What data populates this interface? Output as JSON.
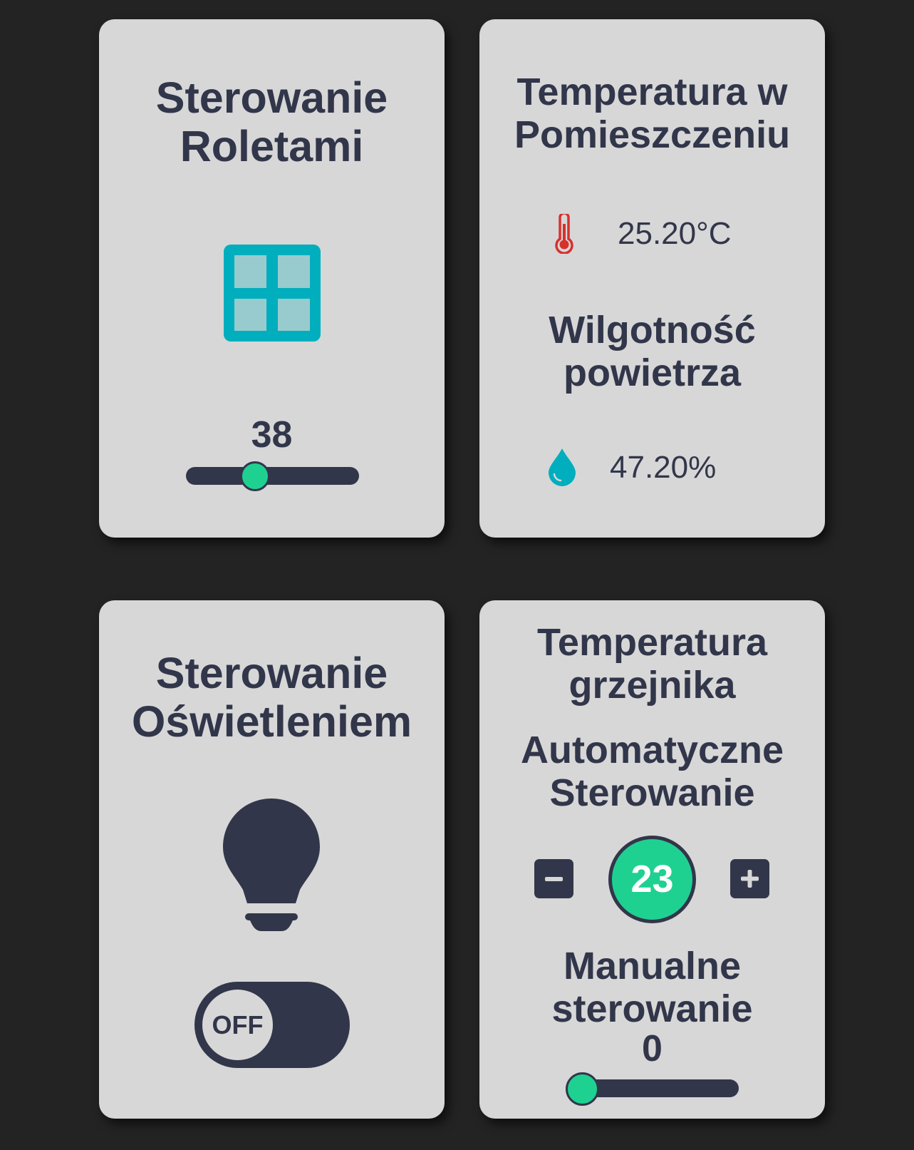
{
  "colors": {
    "background": "#232323",
    "card": "#d7d7d7",
    "text": "#32364a",
    "accent": "#1fd191",
    "window": "#00aebd",
    "thermometer": "#d7312e",
    "drop": "#00aebd"
  },
  "blinds": {
    "title": "Sterowanie\nRoletami",
    "icon": "window-icon",
    "value": "38",
    "slider_level_percent": 38
  },
  "climate": {
    "temperature_title": "Temperatura w\nPomieszczeniu",
    "temperature_icon": "thermometer-icon",
    "temperature_value": "25.20°C",
    "humidity_title": "Wilgotność\npowietrza",
    "humidity_icon": "water-drop-icon",
    "humidity_value": "47.20%"
  },
  "lighting": {
    "title": "Sterowanie\nOświetleniem",
    "icon": "lightbulb-icon",
    "toggle_label": "OFF",
    "toggle_on": false
  },
  "heater": {
    "title": "Temperatura\ngrzejnika",
    "auto_title": "Automatyczne\nSterowanie",
    "decrease_icon": "minus-icon",
    "increase_icon": "plus-icon",
    "setpoint": "23",
    "manual_title": "Manualne\nsterowanie",
    "manual_value": "0",
    "manual_level_percent": 0
  }
}
